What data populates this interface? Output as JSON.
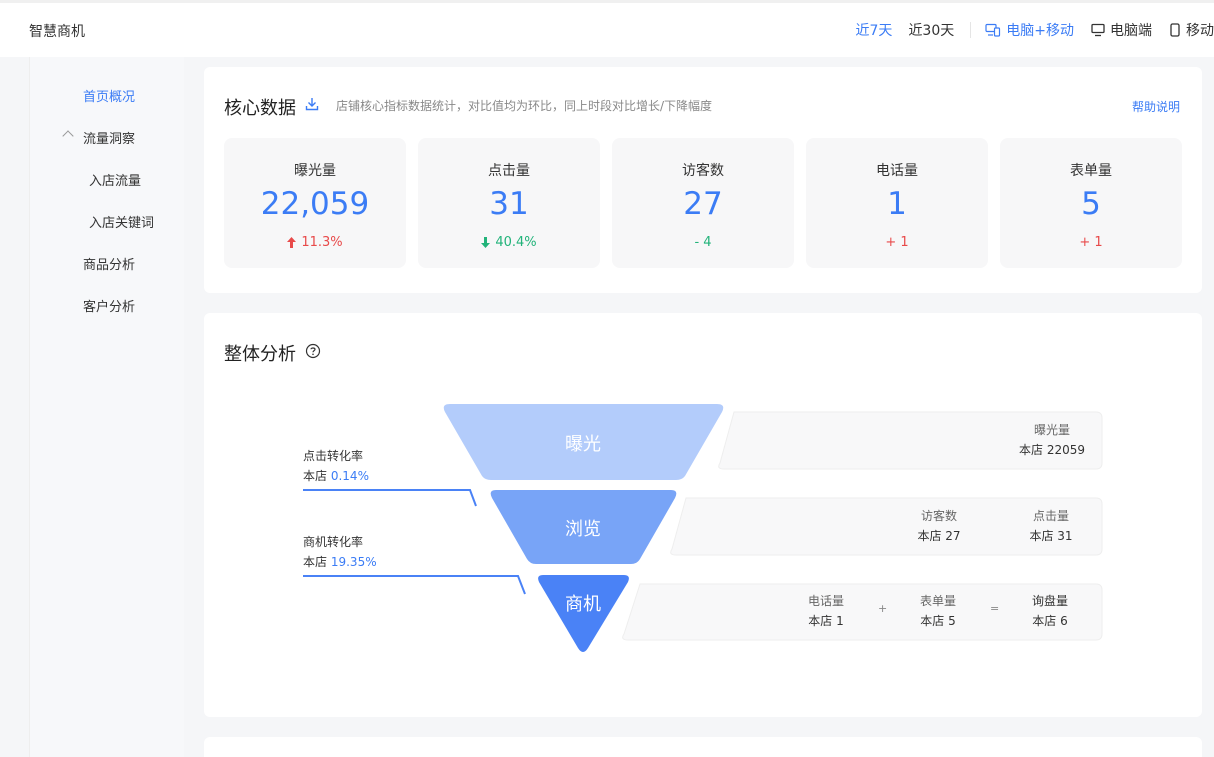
{
  "header": {
    "brand": "智慧商机",
    "ranges": [
      "近7天",
      "近30天"
    ],
    "devices": [
      "电脑+移动",
      "电脑端",
      "移动"
    ]
  },
  "sidebar": {
    "items": [
      "首页概况",
      "流量洞察",
      "入店流量",
      "入店关键词",
      "商品分析",
      "客户分析"
    ]
  },
  "core": {
    "title": "核心数据",
    "desc": "店铺核心指标数据统计，对比值均为环比，同上时段对比增长/下降幅度",
    "help": "帮助说明",
    "metrics": [
      {
        "label": "曝光量",
        "value": "22,059",
        "change": "11.3%"
      },
      {
        "label": "点击量",
        "value": "31",
        "change": "40.4%"
      },
      {
        "label": "访客数",
        "value": "27",
        "change": "- 4"
      },
      {
        "label": "电话量",
        "value": "1",
        "change": "+ 1"
      },
      {
        "label": "表单量",
        "value": "5",
        "change": "+ 1"
      }
    ]
  },
  "overview": {
    "title": "整体分析",
    "stages": [
      "曝光",
      "浏览",
      "商机"
    ],
    "conversions": [
      {
        "label": "点击转化率",
        "prefix": "本店",
        "value": "0.14%"
      },
      {
        "label": "商机转化率",
        "prefix": "本店",
        "value": "19.35%"
      }
    ],
    "panels": {
      "exposure": [
        {
          "label": "曝光量",
          "value": "本店 22059"
        }
      ],
      "browse": [
        {
          "label": "访客数",
          "value": "本店 27"
        },
        {
          "label": "点击量",
          "value": "本店 31"
        }
      ],
      "lead": [
        {
          "label": "电话量",
          "value": "本店 1"
        },
        {
          "label": "表单量",
          "value": "本店 5"
        },
        {
          "label": "询盘量",
          "value": "本店 6"
        }
      ],
      "ops": [
        "+",
        "="
      ]
    }
  },
  "colors": {
    "accent": "#3b7cf5",
    "up": "#e84a4a",
    "down": "#22b37a",
    "funnel_top": "#b3ccfb",
    "funnel_mid": "#78a4f7",
    "funnel_bottom": "#4a82f6"
  }
}
